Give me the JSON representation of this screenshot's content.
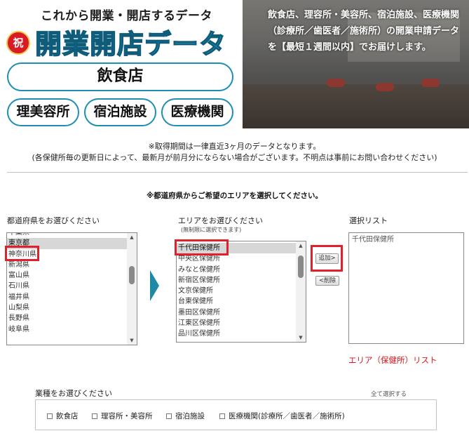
{
  "banner": {
    "tagline": "これから開業・開店するデータ",
    "badge": "祝",
    "brand": "開業開店データ",
    "categories": {
      "restaurant": "飲食店",
      "beauty": "理美容所",
      "lodging": "宿泊施設",
      "medical": "医療機関"
    },
    "description": "飲食店、理容所・美容所、宿泊施設、医療機関（診療所／歯医者／施術所）の開業申請データを【最短１週間以内】でお届けします。"
  },
  "notes": {
    "line1": "※取得期間は一律直近3ヶ月のデータとなります。",
    "line2": "(各保健所毎の更新日によって、最新月が前月分にならない場合がございます。不明点は事前にお問い合わせください)"
  },
  "instruction": "※都道府県からご希望のエリアを選択してください。",
  "prefecture": {
    "label": "都道府県をお選びください",
    "items": [
      "千葉県",
      "東京都",
      "神奈川県",
      "新潟県",
      "富山県",
      "石川県",
      "福井県",
      "山梨県",
      "長野県",
      "岐阜県"
    ],
    "selected": "東京都"
  },
  "area": {
    "label": "エリアをお選びください",
    "sublabel": "(無制限に選択できます)",
    "items": [
      "千代田保健所",
      "中央区保健所",
      "みなと保健所",
      "新宿区保健所",
      "文京保健所",
      "台東保健所",
      "墨田区保健所",
      "江東区保健所",
      "品川区保健所"
    ],
    "selected": "千代田保健所"
  },
  "buttons": {
    "add": "追加>",
    "remove": "<削除"
  },
  "selection": {
    "label": "選択リスト",
    "items": [
      "千代田保健所"
    ],
    "note": "エリア（保健所）リスト"
  },
  "industry": {
    "label": "業種をお選びください",
    "select_all": "全て選択する",
    "options": [
      "飲食店",
      "理容所・美容所",
      "宿泊施設",
      "医療機関(診療所／歯医者／施術所)"
    ]
  },
  "colors": {
    "brand_blue": "#27a6cf",
    "highlight_red": "#e0202a",
    "note_red": "#d9141c",
    "arrow_teal": "#1f8aa5"
  },
  "icons": {
    "badge": "celebration-badge-icon",
    "arrow": "right-arrow-icon",
    "scroll_up": "scroll-up-icon",
    "scroll_down": "scroll-down-icon"
  }
}
